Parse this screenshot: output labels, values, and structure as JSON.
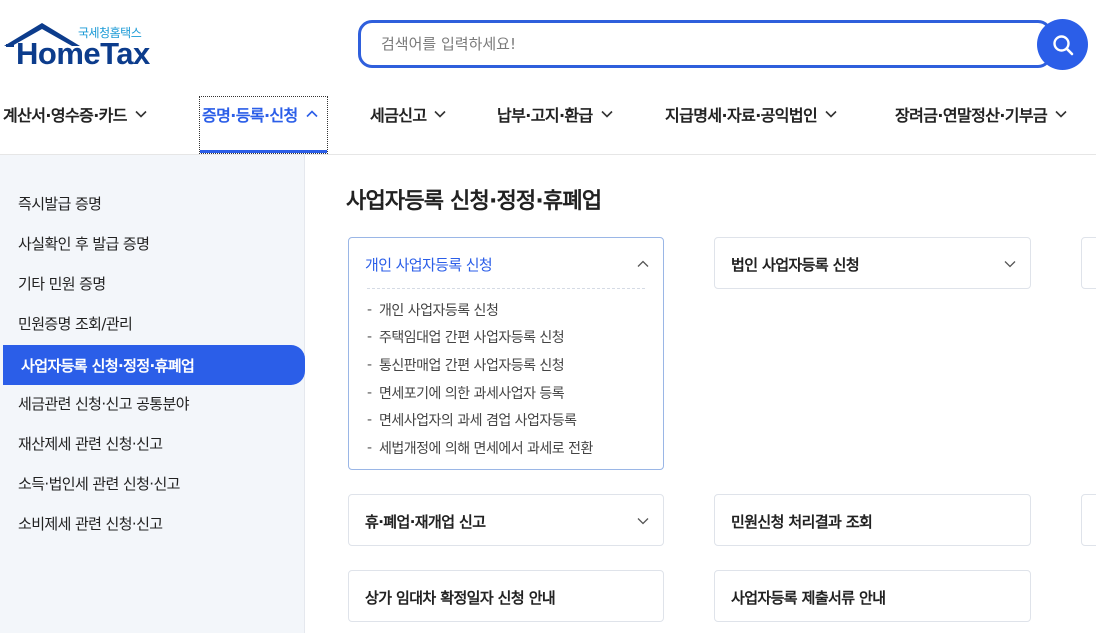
{
  "logo": {
    "tagline": "국세청홈택스",
    "wordmark": "HomeTax"
  },
  "search": {
    "placeholder": "검색어를 입력하세요!"
  },
  "gnb": {
    "items": [
      {
        "label": "계산서·영수증·카드"
      },
      {
        "label": "증명·등록·신청"
      },
      {
        "label": "세금신고"
      },
      {
        "label": "납부·고지·환급"
      },
      {
        "label": "지급명세·자료·공익법인"
      },
      {
        "label": "장려금·연말정산·기부금"
      }
    ]
  },
  "sidebar": {
    "items": [
      {
        "label": "즉시발급 증명"
      },
      {
        "label": "사실확인 후 발급 증명"
      },
      {
        "label": "기타 민원 증명"
      },
      {
        "label": "민원증명 조회/관리"
      },
      {
        "label": "사업자등록 신청·정정·휴폐업"
      },
      {
        "label": "세금관련 신청·신고 공통분야"
      },
      {
        "label": "재산제세 관련 신청·신고"
      },
      {
        "label": "소득·법인세 관련 신청·신고"
      },
      {
        "label": "소비제세 관련 신청·신고"
      }
    ]
  },
  "main": {
    "title": "사업자등록 신청·정정·휴폐업",
    "cards": [
      {
        "title": "개인 사업자등록 신청",
        "subitems": [
          "개인 사업자등록 신청",
          "주택임대업 간편 사업자등록 신청",
          "통신판매업 간편 사업자등록 신청",
          "면세포기에 의한 과세사업자 등록",
          "면세사업자의 과세 겸업 사업자등록",
          "세법개정에 의해 면세에서 과세로 전환"
        ]
      },
      {
        "title": "법인 사업자등록 신청"
      },
      {
        "title": "휴·폐업·재개업 신고"
      },
      {
        "title": "민원신청 처리결과 조회"
      },
      {
        "title": "상가 임대차 확정일자 신청 안내"
      },
      {
        "title": "사업자등록 제출서류 안내"
      }
    ]
  },
  "colors": {
    "accent": "#2b5ee8",
    "brand_navy": "#0c3c8c",
    "sidebar_bg": "#f3f6fa"
  },
  "icons": {
    "search": "search-icon",
    "chevron_down": "chevron-down-icon",
    "chevron_up": "chevron-up-icon"
  }
}
